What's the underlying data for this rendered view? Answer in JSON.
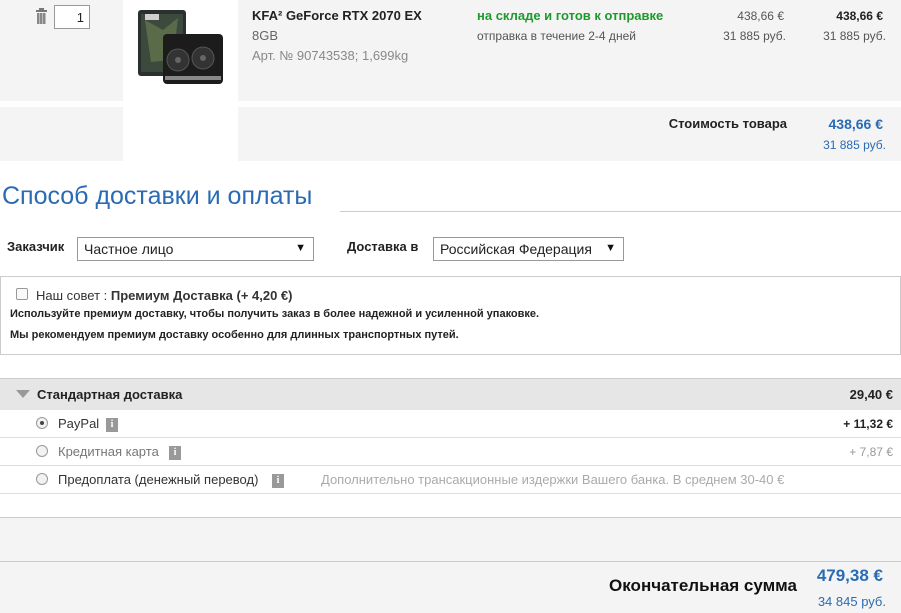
{
  "cart_item": {
    "quantity": "1",
    "title": "KFA² GeForce RTX 2070 EX",
    "memory": "8GB",
    "article": "Арт. № 90743538; 1,699kg",
    "stock_status": "на складе и готов к отправке",
    "shipping_time": "отправка в течение 2-4 дней",
    "unit_price_eur": "438,66 €",
    "unit_price_rub": "31 885 руб.",
    "total_price_eur": "438,66 €",
    "total_price_rub": "31 885 руб."
  },
  "subtotal": {
    "label": "Стоимость товара",
    "eur": "438,66 €",
    "rub": "31 885 руб."
  },
  "section_title": "Способ доставки и оплаты",
  "customer": {
    "label": "Заказчик",
    "value": "Частное лицо"
  },
  "delivery_to": {
    "label": "Доставка в",
    "value": "Российская Федерация"
  },
  "tip": {
    "prefix": "Наш совет : ",
    "offer": "Премиум Доставка (+ 4,20 €)",
    "line1": "Используйте премиум доставку, чтобы получить заказ в более надежной и усиленной упаковке.",
    "line2": "Мы рекомендуем премиум доставку особенно для длинных транспортных путей."
  },
  "shipping": {
    "title": "Стандартная доставка",
    "price": "29,40 €"
  },
  "payment_methods": [
    {
      "label": "PayPal",
      "amount": "+ 11,32 €",
      "selected": true
    },
    {
      "label": "Кредитная карта",
      "amount": "+ 7,87 €",
      "selected": false
    },
    {
      "label": "Предоплата (денежный перевод)",
      "note": "Дополнительно трансакционные издержки Вашего банка. В среднем 30-40 €",
      "selected": false
    }
  ],
  "grand_total": {
    "label": "Окончательная сумма",
    "eur": "479,38 €",
    "rub": "34 845 руб."
  },
  "colors": {
    "accent_blue": "#2a6bb3",
    "in_stock_green": "#1e9a2d"
  }
}
